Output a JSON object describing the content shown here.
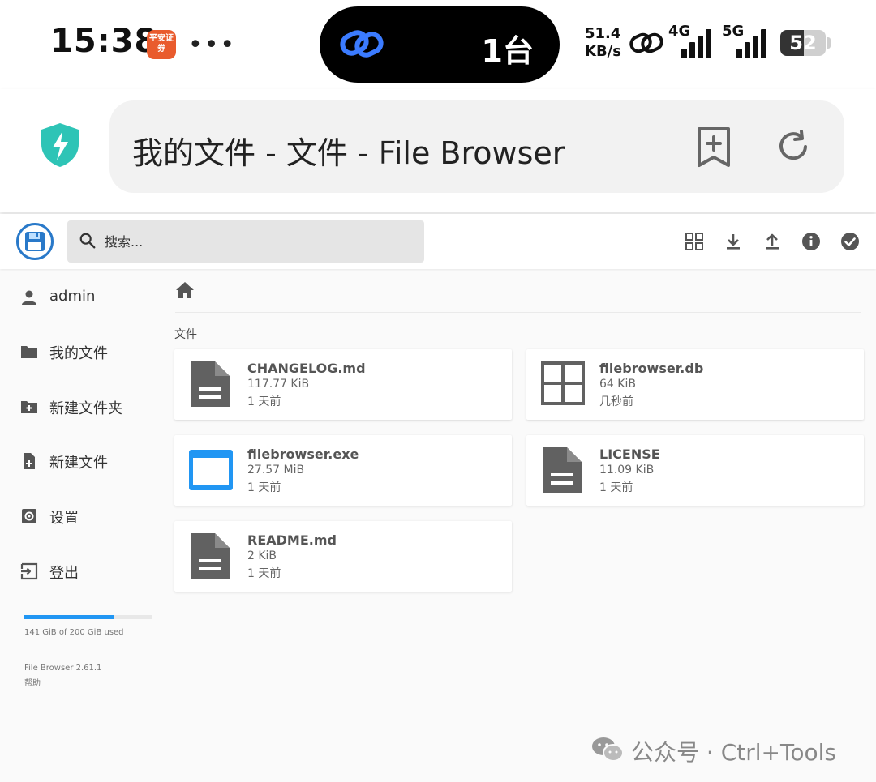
{
  "status_bar": {
    "time": "15:38",
    "app_badge": "平安证券",
    "more": "•••",
    "island_text": "1台",
    "speed_value": "51.4",
    "speed_unit": "KB/s",
    "net_4g": "4G",
    "net_5g": "5G",
    "battery": "52",
    "battery_level": 0.52
  },
  "browser": {
    "page_title": "我的文件 - 文件 - File Browser"
  },
  "header": {
    "search_placeholder": "搜索..."
  },
  "sidebar": {
    "items": [
      {
        "label": "admin"
      },
      {
        "label": "我的文件"
      },
      {
        "label": "新建文件夹"
      },
      {
        "label": "新建文件"
      },
      {
        "label": "设置"
      },
      {
        "label": "登出"
      }
    ],
    "quota_text": "141 GiB of 200 GiB used",
    "quota_used_fraction": 0.705,
    "version": "File Browser 2.61.1",
    "help": "帮助"
  },
  "main": {
    "section_title": "文件",
    "files": [
      {
        "name": "CHANGELOG.md",
        "size": "117.77 KiB",
        "modified": "1 天前",
        "icon": "text-file-icon"
      },
      {
        "name": "filebrowser.db",
        "size": "64 KiB",
        "modified": "几秒前",
        "icon": "database-grid-icon"
      },
      {
        "name": "filebrowser.exe",
        "size": "27.57 MiB",
        "modified": "1 天前",
        "icon": "executable-window-icon"
      },
      {
        "name": "LICENSE",
        "size": "11.09 KiB",
        "modified": "1 天前",
        "icon": "text-file-icon"
      },
      {
        "name": "README.md",
        "size": "2 KiB",
        "modified": "1 天前",
        "icon": "text-file-icon"
      }
    ]
  },
  "watermark": {
    "text": "公众号 · Ctrl+Tools"
  },
  "colors": {
    "accent": "#2196f3",
    "icon_gray": "#555555",
    "shield_teal": "#2ec4b6"
  }
}
